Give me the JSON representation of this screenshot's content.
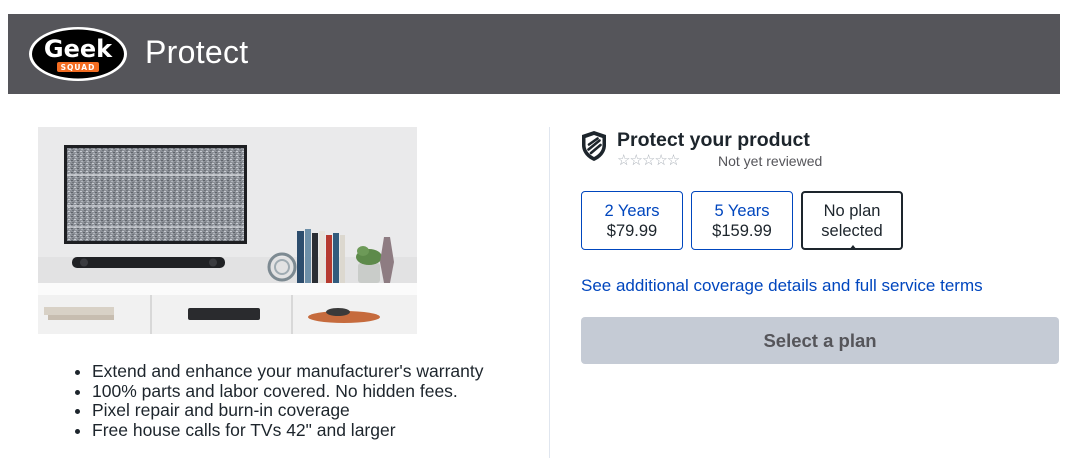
{
  "header": {
    "logo_text": "Geek",
    "logo_subtext": "SQUAD",
    "title": "Protect"
  },
  "features": [
    "Extend and enhance your manufacturer's warranty",
    "100% parts and labor covered. No hidden fees.",
    "Pixel repair and burn-in coverage",
    "Free house calls for TVs 42\" and larger"
  ],
  "panel": {
    "title": "Protect your product",
    "stars": "☆☆☆☆☆",
    "rating": 0,
    "review_text": "Not yet reviewed"
  },
  "plans": [
    {
      "duration": "2 Years",
      "price": "$79.99",
      "selected": false
    },
    {
      "duration": "5 Years",
      "price": "$159.99",
      "selected": false
    },
    {
      "line1": "No plan",
      "line2": "selected",
      "selected": true
    }
  ],
  "coverage_link": "See additional coverage details and full service terms",
  "select_button": "Select a plan",
  "colors": {
    "header_bg": "#55555a",
    "link_blue": "#0046be",
    "logo_orange": "#f36c21",
    "button_disabled_bg": "#c5cbd5"
  },
  "icons": {
    "shield": "shield-icon",
    "star": "star-outline-icon"
  }
}
